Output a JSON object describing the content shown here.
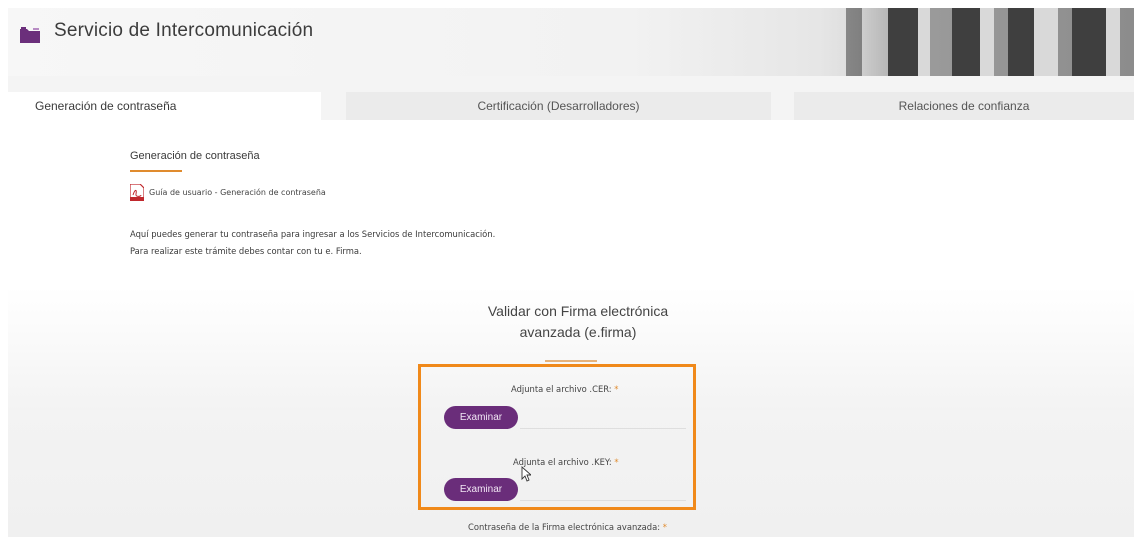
{
  "header": {
    "title": "Servicio de Intercomunicación",
    "icon": "folder-icon"
  },
  "tabs": [
    {
      "label": "Generación de contraseña",
      "active": true
    },
    {
      "label": "Certificación (Desarrolladores)",
      "active": false
    },
    {
      "label": "Relaciones de confianza",
      "active": false
    }
  ],
  "content": {
    "section_title": "Generación de contraseña",
    "guide_link": "Guía de usuario - Generación de contraseña",
    "description_line1": "Aquí puedes generar tu contraseña para ingresar a los Servicios de Intercomunicación.",
    "description_line2": "Para realizar este trámite debes contar con tu e. Firma."
  },
  "form": {
    "heading_line1": "Validar con Firma electrónica",
    "heading_line2": "avanzada (e.firma)",
    "cer_label": "Adjunta el archivo .CER:",
    "key_label": "Adjunta el archivo .KEY:",
    "required_mark": "*",
    "browse_label": "Examinar",
    "password_label": "Contraseña de la Firma electrónica avanzada:"
  },
  "colors": {
    "accent_orange": "#f0891a",
    "button_purple": "#6a2d7a",
    "brand_purple": "#6b2f7b"
  }
}
